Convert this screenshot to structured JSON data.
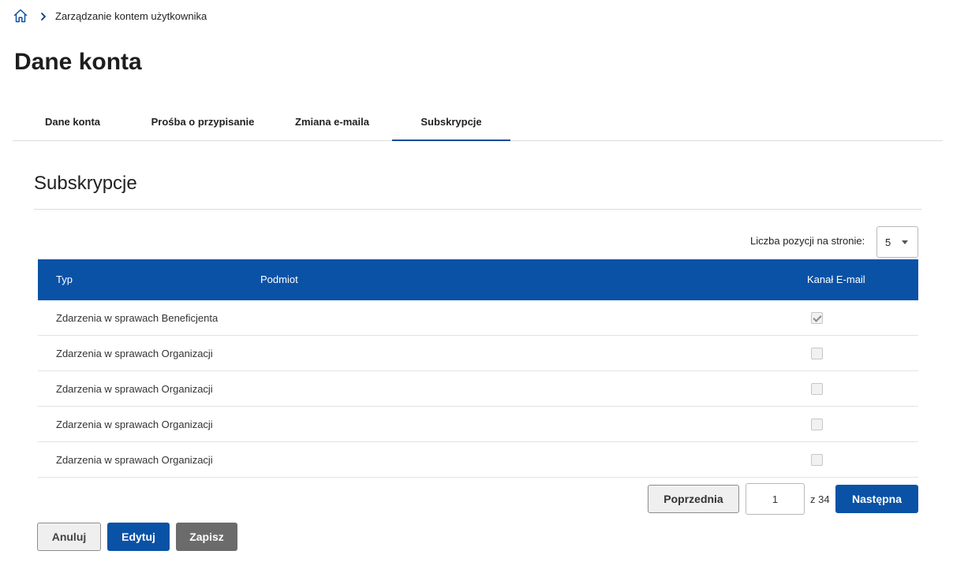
{
  "breadcrumb": {
    "home_icon": "home-icon",
    "separator_icon": "chevron-right-icon",
    "current": "Zarządzanie kontem użytkownika"
  },
  "page": {
    "title": "Dane konta"
  },
  "tabs": [
    {
      "label": "Dane konta",
      "active": false
    },
    {
      "label": "Prośba o przypisanie",
      "active": false
    },
    {
      "label": "Zmiana e-maila",
      "active": false
    },
    {
      "label": "Subskrypcje",
      "active": true
    }
  ],
  "section": {
    "title": "Subskrypcje"
  },
  "per_page": {
    "label": "Liczba pozycji na stronie:",
    "value": "5"
  },
  "table": {
    "headers": {
      "typ": "Typ",
      "podmiot": "Podmiot",
      "kanal": "Kanał E-mail"
    },
    "rows": [
      {
        "typ": "Zdarzenia w sprawach Beneficjenta",
        "podmiot": "",
        "email": true
      },
      {
        "typ": "Zdarzenia w sprawach Organizacji",
        "podmiot": "",
        "email": false
      },
      {
        "typ": "Zdarzenia w sprawach Organizacji",
        "podmiot": "",
        "email": false
      },
      {
        "typ": "Zdarzenia w sprawach Organizacji",
        "podmiot": "",
        "email": false
      },
      {
        "typ": "Zdarzenia w sprawach Organizacji",
        "podmiot": "",
        "email": false
      }
    ]
  },
  "pagination": {
    "prev_label": "Poprzednia",
    "current_page": "1",
    "of_text": "z 34",
    "next_label": "Następna"
  },
  "actions": {
    "cancel": "Anuluj",
    "edit": "Edytuj",
    "save": "Zapisz"
  },
  "colors": {
    "primary": "#0a52a6",
    "tab_underline": "#0a4b9b",
    "save_bg": "#6b6b6b"
  }
}
